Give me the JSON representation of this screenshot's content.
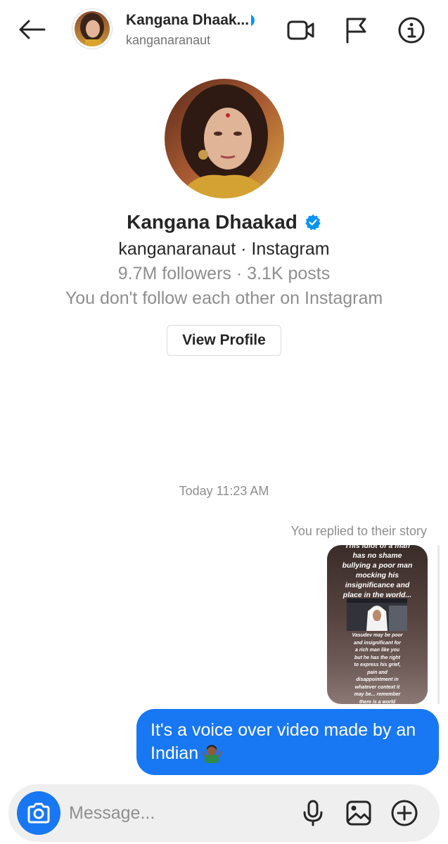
{
  "header": {
    "name": "Kangana Dhaak...",
    "username": "kanganaranaut",
    "icons": [
      "back-arrow-icon",
      "video-call-icon",
      "flag-icon",
      "info-icon"
    ]
  },
  "profile": {
    "name": "Kangana Dhaakad",
    "verified": true,
    "handle_line": "kanganaranaut · Instagram",
    "stats_line": "9.7M followers · 3.1K posts",
    "follow_line": "You don't follow each other on Instagram",
    "view_profile_label": "View Profile"
  },
  "thread": {
    "timestamp": "Today 11:23 AM",
    "reply_note": "You replied to their story",
    "story": {
      "text_top": "This idiot of a man\nhas no shame\nbullying a poor man\nmocking his\ninsignificance and\nplace in the world...",
      "text_bottom": "Vasudev may be poor\nand insignificant for\na rich man like you\nbut he has the right\nto express his grief,\npain and\ndisappointment in\nwhatever context it\nmay be... remember\nthere is a world\nbeyond this world\nwhere we all are"
    },
    "message": "It's a voice over video made by an Indian"
  },
  "composer": {
    "placeholder": "Message...",
    "icons": [
      "camera-icon",
      "microphone-icon",
      "gallery-icon",
      "add-icon"
    ]
  },
  "colors": {
    "accent": "#1877f2",
    "verified": "#0095f6",
    "composer_bg": "#efefef",
    "secondary_text": "#8e8e8e"
  }
}
